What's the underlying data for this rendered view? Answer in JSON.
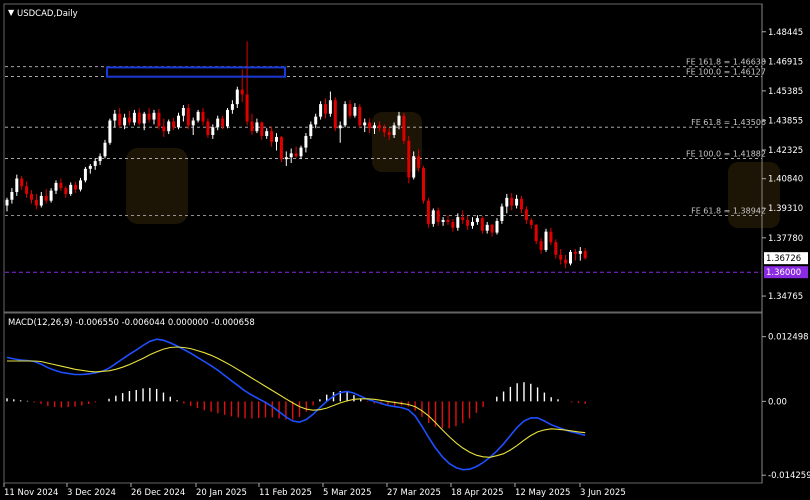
{
  "window": {
    "title": "USDCAD,Daily",
    "menu_icon": "triangle-down-icon"
  },
  "colors": {
    "background": "#000000",
    "bull": "#ffffff",
    "bear": "#e00000",
    "grid_line": "#c0c0c0",
    "support_line": "#8a2be2",
    "box": "#1c39d6",
    "macd_line": "#1e4fff",
    "signal_line": "#e8e23a",
    "hist_pos": "#ffffff",
    "hist_neg": "#e01010",
    "price_tag_bg": "#ffffff",
    "support_tag_bg": "#8a2be2"
  },
  "chart_data": [
    {
      "type": "candlestick",
      "title": "USDCAD,Daily",
      "ylim": [
        1.3425,
        1.4895
      ],
      "y_ticks": [
        "1.48445",
        "1.46915",
        "1.45385",
        "1.43855",
        "1.42325",
        "1.40840",
        "1.39310",
        "1.37780",
        "1.34765"
      ],
      "x_tick_labels": [
        "11 Nov 2024",
        "3 Dec 2024",
        "26 Dec 2024",
        "20 Jan 2025",
        "11 Feb 2025",
        "5 Mar 2025",
        "27 Mar 2025",
        "18 Apr 2025",
        "12 May 2025",
        "3 Jun 2025"
      ],
      "current_price_label": "1.36726",
      "support_label": "1.36000",
      "support_level": 1.36,
      "fe_levels": [
        {
          "label": "FE 161.8 = 1.46638",
          "value": 1.46638
        },
        {
          "label": "FE 100.0 = 1.46127",
          "value": 1.46127
        },
        {
          "label": "FE 61.8 = 1.43506",
          "value": 1.43506
        },
        {
          "label": "FE 100.0 = 1.41882",
          "value": 1.41882
        },
        {
          "label": "FE 61.8 = 1.38942",
          "value": 1.38942
        }
      ],
      "highlight_box": {
        "bar_from": 30,
        "bar_to": 72,
        "price_high": 1.466,
        "price_low": 1.4612
      },
      "candles": [
        [
          1.3945,
          1.3985,
          1.3915,
          1.3975
        ],
        [
          1.3975,
          1.4035,
          1.3955,
          1.4015
        ],
        [
          1.4015,
          1.4105,
          1.3995,
          1.4085
        ],
        [
          1.4085,
          1.4098,
          1.4025,
          1.4045
        ],
        [
          1.4045,
          1.407,
          1.3985,
          1.4005
        ],
        [
          1.4005,
          1.4025,
          1.3955,
          1.3975
        ],
        [
          1.3975,
          1.4005,
          1.3925,
          1.3945
        ],
        [
          1.3945,
          1.4015,
          1.3935,
          1.3995
        ],
        [
          1.3995,
          1.403,
          1.3955,
          1.397
        ],
        [
          1.397,
          1.4035,
          1.396,
          1.4022
        ],
        [
          1.4022,
          1.4075,
          1.4005,
          1.4062
        ],
        [
          1.4062,
          1.4085,
          1.402,
          1.4035
        ],
        [
          1.4035,
          1.4045,
          1.3985,
          1.4005
        ],
        [
          1.4005,
          1.4065,
          1.3995,
          1.4052
        ],
        [
          1.4052,
          1.4068,
          1.401,
          1.4028
        ],
        [
          1.4028,
          1.4088,
          1.4018,
          1.4075
        ],
        [
          1.4075,
          1.4145,
          1.4065,
          1.4135
        ],
        [
          1.4135,
          1.416,
          1.411,
          1.415
        ],
        [
          1.415,
          1.419,
          1.413,
          1.4175
        ],
        [
          1.4175,
          1.4215,
          1.4155,
          1.42
        ],
        [
          1.42,
          1.4285,
          1.419,
          1.427
        ],
        [
          1.427,
          1.4395,
          1.426,
          1.4385
        ],
        [
          1.4385,
          1.444,
          1.435,
          1.442
        ],
        [
          1.442,
          1.445,
          1.4345,
          1.436
        ],
        [
          1.436,
          1.442,
          1.434,
          1.44
        ],
        [
          1.44,
          1.4435,
          1.436,
          1.4375
        ],
        [
          1.4375,
          1.444,
          1.436,
          1.4425
        ],
        [
          1.4425,
          1.4448,
          1.436,
          1.437
        ],
        [
          1.437,
          1.443,
          1.4335,
          1.442
        ],
        [
          1.442,
          1.445,
          1.4375,
          1.439
        ],
        [
          1.439,
          1.444,
          1.4365,
          1.4425
        ],
        [
          1.4425,
          1.4445,
          1.434,
          1.4355
        ],
        [
          1.4355,
          1.4395,
          1.43,
          1.433
        ],
        [
          1.433,
          1.439,
          1.4315,
          1.438
        ],
        [
          1.438,
          1.44,
          1.4335,
          1.435
        ],
        [
          1.435,
          1.4425,
          1.434,
          1.441
        ],
        [
          1.441,
          1.4465,
          1.438,
          1.445
        ],
        [
          1.445,
          1.447,
          1.434,
          1.436
        ],
        [
          1.436,
          1.44,
          1.431,
          1.4385
        ],
        [
          1.4385,
          1.444,
          1.4375,
          1.443
        ],
        [
          1.443,
          1.445,
          1.436,
          1.438
        ],
        [
          1.438,
          1.4395,
          1.4295,
          1.431
        ],
        [
          1.431,
          1.4365,
          1.429,
          1.435
        ],
        [
          1.435,
          1.441,
          1.4335,
          1.4395
        ],
        [
          1.4395,
          1.441,
          1.434,
          1.4355
        ],
        [
          1.4355,
          1.445,
          1.4345,
          1.444
        ],
        [
          1.444,
          1.449,
          1.442,
          1.447
        ],
        [
          1.447,
          1.456,
          1.445,
          1.4545
        ],
        [
          1.4545,
          1.465,
          1.448,
          1.452
        ],
        [
          1.452,
          1.4795,
          1.436,
          1.438
        ],
        [
          1.438,
          1.442,
          1.431,
          1.433
        ],
        [
          1.433,
          1.4395,
          1.432,
          1.4375
        ],
        [
          1.4375,
          1.438,
          1.4285,
          1.4305
        ],
        [
          1.4305,
          1.4345,
          1.429,
          1.433
        ],
        [
          1.433,
          1.4355,
          1.425,
          1.4275
        ],
        [
          1.4275,
          1.432,
          1.423,
          1.43
        ],
        [
          1.43,
          1.4305,
          1.417,
          1.4185
        ],
        [
          1.4185,
          1.4225,
          1.415,
          1.4195
        ],
        [
          1.4195,
          1.424,
          1.4165,
          1.4215
        ],
        [
          1.4215,
          1.425,
          1.419,
          1.42
        ],
        [
          1.42,
          1.4255,
          1.4185,
          1.4245
        ],
        [
          1.4245,
          1.432,
          1.422,
          1.4305
        ],
        [
          1.4305,
          1.438,
          1.429,
          1.4365
        ],
        [
          1.4365,
          1.442,
          1.4345,
          1.4405
        ],
        [
          1.4405,
          1.4485,
          1.439,
          1.447
        ],
        [
          1.447,
          1.45,
          1.4395,
          1.442
        ],
        [
          1.442,
          1.4535,
          1.4405,
          1.449
        ],
        [
          1.449,
          1.4505,
          1.433,
          1.4345
        ],
        [
          1.4345,
          1.438,
          1.427,
          1.436
        ],
        [
          1.436,
          1.4485,
          1.435,
          1.447
        ],
        [
          1.447,
          1.449,
          1.4395,
          1.441
        ],
        [
          1.441,
          1.4475,
          1.44,
          1.4455
        ],
        [
          1.4455,
          1.447,
          1.4345,
          1.436
        ],
        [
          1.436,
          1.4395,
          1.4325,
          1.4375
        ],
        [
          1.4375,
          1.4395,
          1.432,
          1.4345
        ],
        [
          1.4345,
          1.4375,
          1.4315,
          1.436
        ],
        [
          1.436,
          1.438,
          1.433,
          1.4345
        ],
        [
          1.4345,
          1.4365,
          1.43,
          1.4325
        ],
        [
          1.4325,
          1.4345,
          1.4285,
          1.431
        ],
        [
          1.431,
          1.4375,
          1.4295,
          1.436
        ],
        [
          1.436,
          1.443,
          1.434,
          1.441
        ],
        [
          1.441,
          1.4425,
          1.4265,
          1.428
        ],
        [
          1.428,
          1.4305,
          1.406,
          1.409
        ],
        [
          1.409,
          1.4225,
          1.408,
          1.42
        ],
        [
          1.42,
          1.4235,
          1.412,
          1.414
        ],
        [
          1.414,
          1.415,
          1.3955,
          1.397
        ],
        [
          1.397,
          1.3985,
          1.383,
          1.385
        ],
        [
          1.385,
          1.393,
          1.3835,
          1.392
        ],
        [
          1.392,
          1.3935,
          1.384,
          1.386
        ],
        [
          1.386,
          1.3885,
          1.384,
          1.387
        ],
        [
          1.387,
          1.3895,
          1.3845,
          1.386
        ],
        [
          1.386,
          1.3875,
          1.381,
          1.383
        ],
        [
          1.383,
          1.3905,
          1.3815,
          1.3885
        ],
        [
          1.3885,
          1.392,
          1.385,
          1.387
        ],
        [
          1.387,
          1.389,
          1.382,
          1.384
        ],
        [
          1.384,
          1.3885,
          1.3825,
          1.386
        ],
        [
          1.386,
          1.3895,
          1.3845,
          1.388
        ],
        [
          1.388,
          1.389,
          1.38,
          1.3815
        ],
        [
          1.3815,
          1.386,
          1.38,
          1.3845
        ],
        [
          1.3845,
          1.385,
          1.3785,
          1.3805
        ],
        [
          1.3805,
          1.388,
          1.3795,
          1.3865
        ],
        [
          1.3865,
          1.3955,
          1.385,
          1.394
        ],
        [
          1.394,
          1.4005,
          1.3905,
          1.3985
        ],
        [
          1.3985,
          1.401,
          1.392,
          1.3945
        ],
        [
          1.3945,
          1.4,
          1.393,
          1.398
        ],
        [
          1.398,
          1.3995,
          1.3905,
          1.3925
        ],
        [
          1.3925,
          1.394,
          1.385,
          1.387
        ],
        [
          1.387,
          1.388,
          1.3825,
          1.3845
        ],
        [
          1.3845,
          1.385,
          1.3745,
          1.376
        ],
        [
          1.376,
          1.3775,
          1.3695,
          1.3715
        ],
        [
          1.3715,
          1.3825,
          1.3705,
          1.381
        ],
        [
          1.381,
          1.383,
          1.374,
          1.3755
        ],
        [
          1.3755,
          1.377,
          1.367,
          1.369
        ],
        [
          1.369,
          1.372,
          1.364,
          1.3665
        ],
        [
          1.3665,
          1.369,
          1.362,
          1.3645
        ],
        [
          1.3645,
          1.3715,
          1.3635,
          1.3705
        ],
        [
          1.3705,
          1.372,
          1.366,
          1.3695
        ],
        [
          1.3695,
          1.373,
          1.366,
          1.371
        ],
        [
          1.371,
          1.3725,
          1.3665,
          1.36726
        ]
      ]
    },
    {
      "type": "line",
      "title": "MACD(12,26,9) -0.006550 -0.006044 0.000000 -0.000658",
      "ylim": [
        -0.0148,
        0.0134
      ],
      "y_ticks": [
        "0.012498",
        "0.00",
        "-0.014259"
      ],
      "series": [
        {
          "name": "MACD",
          "values": [
            0.0085,
            0.0082,
            0.008,
            0.0079,
            0.0077,
            0.0072,
            0.0065,
            0.006,
            0.0056,
            0.0054,
            0.0052,
            0.0052,
            0.0053,
            0.0055,
            0.0058,
            0.0064,
            0.0073,
            0.0082,
            0.0091,
            0.0099,
            0.0108,
            0.0116,
            0.012,
            0.0118,
            0.0113,
            0.0107,
            0.01,
            0.0093,
            0.0085,
            0.0077,
            0.0069,
            0.006,
            0.005,
            0.004,
            0.003,
            0.002,
            0.0012,
            0.0005,
            -0.0002,
            -0.001,
            -0.002,
            -0.003,
            -0.0038,
            -0.004,
            -0.0035,
            -0.0025,
            -0.0012,
            0.0,
            0.001,
            0.0017,
            0.0019,
            0.0016,
            0.001,
            0.0004,
            0.0,
            -0.0004,
            -0.0008,
            -0.001,
            -0.0012,
            -0.0016,
            -0.0028,
            -0.0048,
            -0.007,
            -0.009,
            -0.0107,
            -0.012,
            -0.0128,
            -0.0132,
            -0.0131,
            -0.0126,
            -0.0118,
            -0.0108,
            -0.0096,
            -0.0082,
            -0.0066,
            -0.005,
            -0.0038,
            -0.0032,
            -0.0032,
            -0.0038,
            -0.0045,
            -0.005,
            -0.0055,
            -0.0059,
            -0.0062,
            -0.00655
          ]
        },
        {
          "name": "Signal",
          "values": [
            0.0078,
            0.0078,
            0.0078,
            0.0078,
            0.0078,
            0.0077,
            0.0074,
            0.0071,
            0.0068,
            0.0065,
            0.0062,
            0.006,
            0.0058,
            0.0057,
            0.0058,
            0.0059,
            0.0062,
            0.0066,
            0.0071,
            0.0077,
            0.0083,
            0.009,
            0.0096,
            0.0101,
            0.0104,
            0.0105,
            0.0104,
            0.0102,
            0.0098,
            0.0094,
            0.0089,
            0.0083,
            0.0076,
            0.0069,
            0.0061,
            0.0053,
            0.0045,
            0.0037,
            0.0029,
            0.0021,
            0.0013,
            0.0005,
            -0.0003,
            -0.001,
            -0.0015,
            -0.0017,
            -0.0016,
            -0.0013,
            -0.0008,
            -0.0003,
            0.0001,
            0.0004,
            0.0005,
            0.0005,
            0.0004,
            0.0002,
            0.0,
            -0.0002,
            -0.0004,
            -0.0006,
            -0.001,
            -0.0018,
            -0.0028,
            -0.0041,
            -0.0055,
            -0.0068,
            -0.008,
            -0.009,
            -0.0098,
            -0.0104,
            -0.0107,
            -0.0108,
            -0.0105,
            -0.0101,
            -0.0094,
            -0.0085,
            -0.0075,
            -0.0066,
            -0.0059,
            -0.0055,
            -0.0053,
            -0.0054,
            -0.0055,
            -0.0057,
            -0.0059,
            -0.006044
          ]
        }
      ],
      "histogram": [
        0.0006,
        0.0004,
        0.0002,
        0.0001,
        -0.0002,
        -0.0005,
        -0.0009,
        -0.0011,
        -0.0012,
        -0.0011,
        -0.001,
        -0.0008,
        -0.0005,
        -0.0002,
        0.0,
        0.0005,
        0.0011,
        0.0016,
        0.002,
        0.0022,
        0.0025,
        0.0026,
        0.0024,
        0.0017,
        0.0009,
        0.0002,
        -0.0004,
        -0.0009,
        -0.0013,
        -0.0017,
        -0.002,
        -0.0023,
        -0.0026,
        -0.0029,
        -0.0031,
        -0.0033,
        -0.0033,
        -0.0032,
        -0.0031,
        -0.0031,
        -0.0033,
        -0.0035,
        -0.0035,
        -0.003,
        -0.002,
        -0.0008,
        0.0004,
        0.0013,
        0.0018,
        0.002,
        0.0018,
        0.0012,
        0.0005,
        -0.0001,
        -0.0004,
        -0.0006,
        -0.0008,
        -0.0008,
        -0.0008,
        -0.001,
        -0.0018,
        -0.003,
        -0.0042,
        -0.0049,
        -0.0052,
        -0.0052,
        -0.0048,
        -0.0042,
        -0.0033,
        -0.0022,
        -0.0011,
        0.0,
        0.0009,
        0.0019,
        0.0028,
        0.0035,
        0.0037,
        0.0034,
        0.0027,
        0.0017,
        0.0008,
        0.0004,
        0.0,
        -0.0002,
        -0.0003,
        -0.0005
      ]
    }
  ]
}
